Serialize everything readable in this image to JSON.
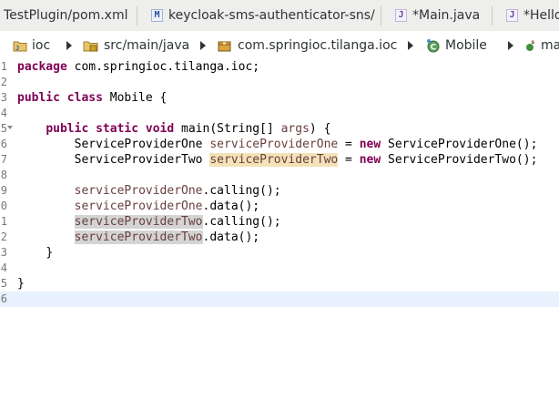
{
  "tabs": [
    {
      "label": "TestPlugin/pom.xml",
      "icon": "none"
    },
    {
      "label": "keycloak-sms-authenticator-sns/",
      "icon": "maven-pom-icon"
    },
    {
      "label": "*Main.java",
      "icon": "java-file-icon"
    },
    {
      "label": "*Hello",
      "icon": "java-file-icon"
    }
  ],
  "breadcrumb": {
    "project": "ioc",
    "source_folder": "src/main/java",
    "package": "com.springioc.tilanga.ioc",
    "class": "Mobile",
    "method": "ma"
  },
  "editor": {
    "lines": [
      {
        "num": "1",
        "kw": "package",
        "rest": " com.springioc.tilanga.ioc;"
      },
      {
        "num": "2"
      },
      {
        "num": "3",
        "kw": "public class",
        "rest": " Mobile {"
      },
      {
        "num": "4"
      },
      {
        "num": "5",
        "indent": "    ",
        "kw": "public static void",
        "rest": " main(String[] ",
        "param": "args",
        "tail": ") {"
      },
      {
        "num": "6",
        "indent": "        ",
        "type": "ServiceProviderOne ",
        "var": "serviceProviderOne",
        "op": " = ",
        "kw": "new",
        "tail": " ServiceProviderOne();"
      },
      {
        "num": "7",
        "indent": "        ",
        "type": "ServiceProviderTwo ",
        "var": "serviceProviderTwo",
        "op": " = ",
        "kw": "new",
        "tail": " ServiceProviderTwo();"
      },
      {
        "num": "8"
      },
      {
        "num": "9",
        "indent": "        ",
        "var": "serviceProviderOne",
        "tail": ".calling();"
      },
      {
        "num": "0",
        "indent": "        ",
        "var": "serviceProviderOne",
        "tail": ".data();"
      },
      {
        "num": "1",
        "indent": "        ",
        "var": "serviceProviderTwo",
        "tail": ".calling();"
      },
      {
        "num": "2",
        "indent": "        ",
        "var": "serviceProviderTwo",
        "tail": ".data();"
      },
      {
        "num": "3",
        "indent": "    ",
        "tail": "}"
      },
      {
        "num": "4"
      },
      {
        "num": "5",
        "tail": "}"
      },
      {
        "num": "6"
      }
    ]
  },
  "colors": {
    "keyword": "#7f0055",
    "field": "#6a3e3e",
    "occurrence_write": "#f4e2b8",
    "occurrence_read": "#d4d4d4",
    "current_line": "#e8f2fe"
  }
}
